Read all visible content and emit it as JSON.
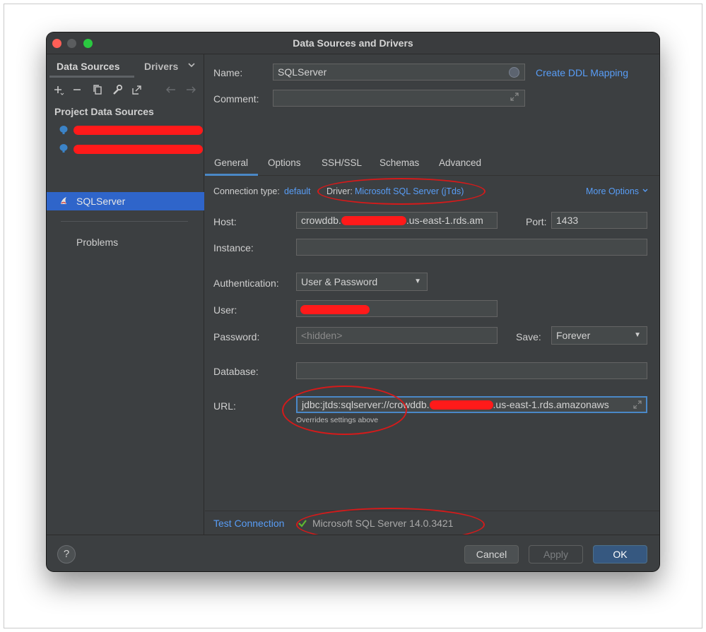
{
  "window": {
    "title": "Data Sources and Drivers"
  },
  "sidebar": {
    "tabs": [
      "Data Sources",
      "Drivers"
    ],
    "section_title": "Project Data Sources",
    "items": [
      {
        "label": "",
        "redacted": true
      },
      {
        "label": "",
        "redacted": true
      },
      {
        "label": "SQLServer",
        "selected": true
      }
    ],
    "problems": "Problems"
  },
  "form": {
    "name_label": "Name:",
    "name_value": "SQLServer",
    "create_ddl": "Create DDL Mapping",
    "comment_label": "Comment:",
    "comment_value": "",
    "tabs": [
      "General",
      "Options",
      "SSH/SSL",
      "Schemas",
      "Advanced"
    ],
    "connection_type_label": "Connection type:",
    "connection_type_value": "default",
    "driver_label": "Driver:",
    "driver_value": "Microsoft SQL Server (jTds)",
    "more_options": "More Options",
    "host_label": "Host:",
    "host_value_prefix": "crowddb.",
    "host_value_suffix": ".us-east-1.rds.am",
    "port_label": "Port:",
    "port_value": "1433",
    "instance_label": "Instance:",
    "instance_value": "",
    "auth_label": "Authentication:",
    "auth_value": "User & Password",
    "user_label": "User:",
    "password_label": "Password:",
    "password_placeholder": "<hidden>",
    "save_label": "Save:",
    "save_value": "Forever",
    "database_label": "Database:",
    "database_value": "",
    "url_label": "URL:",
    "url_prefix": "jdbc:jtds:sqlserver://crowddb.",
    "url_suffix": ".us-east-1.rds.amazonaws",
    "url_note": "Overrides settings above"
  },
  "status": {
    "test_connection": "Test Connection",
    "result": "Microsoft SQL Server 14.0.3421"
  },
  "footer": {
    "help": "?",
    "cancel": "Cancel",
    "apply": "Apply",
    "ok": "OK"
  },
  "colors": {
    "accent": "#589df6",
    "selection": "#2f65ca",
    "annotation": "#d61a1a",
    "success": "#5fb832"
  }
}
